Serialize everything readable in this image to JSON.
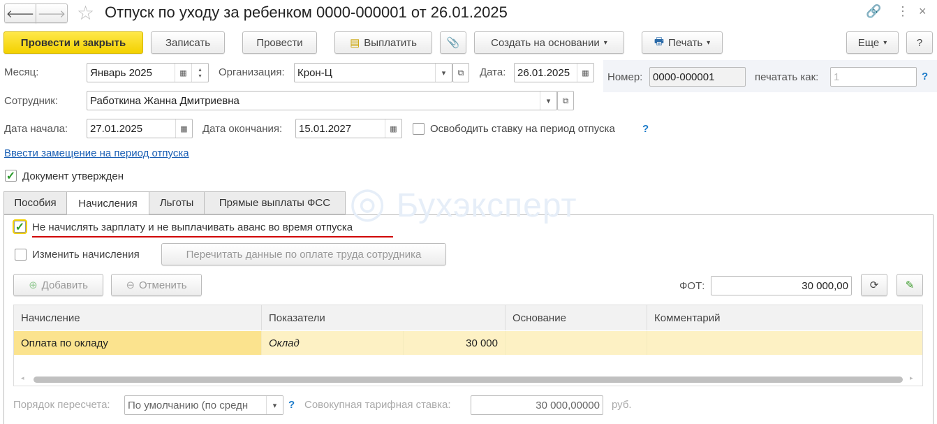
{
  "title": "Отпуск по уходу за ребенком 0000-000001 от 26.01.2025",
  "toolbar": {
    "post_close": "Провести и закрыть",
    "save": "Записать",
    "post": "Провести",
    "pay": "Выплатить",
    "create_based": "Создать на основании",
    "print": "Печать",
    "more": "Еще",
    "help": "?"
  },
  "form": {
    "month_label": "Месяц:",
    "month": "Январь 2025",
    "org_label": "Организация:",
    "org": "Крон-Ц",
    "date_label": "Дата:",
    "date": "26.01.2025",
    "number_label": "Номер:",
    "number": "0000-000001",
    "print_as_label": "печатать как:",
    "print_as": "1",
    "employee_label": "Сотрудник:",
    "employee": "Работкина Жанна Дмитриевна",
    "start_label": "Дата начала:",
    "start": "27.01.2025",
    "end_label": "Дата окончания:",
    "end": "15.01.2027",
    "free_rate_label": "Освободить ставку на период отпуска",
    "replacement_link": "Ввести замещение на период отпуска",
    "approved_label": "Документ утвержден",
    "help": "?"
  },
  "tabs": [
    {
      "label": "Пособия"
    },
    {
      "label": "Начисления"
    },
    {
      "label": "Льготы"
    },
    {
      "label": "Прямые выплаты ФСС"
    }
  ],
  "watermark": "Бухэксперт",
  "accruals": {
    "no_salary_label": "Не начислять зарплату и не выплачивать аванс во время отпуска",
    "change_label": "Изменить начисления",
    "reread_button": "Перечитать данные по оплате труда сотрудника",
    "add": "Добавить",
    "cancel": "Отменить",
    "fot_label": "ФОТ:",
    "fot": "30 000,00",
    "columns": [
      "Начисление",
      "Показатели",
      "Основание",
      "Комментарий"
    ],
    "rows": [
      {
        "accrual": "Оплата по окладу",
        "indicator": "Оклад",
        "value": "30 000",
        "basis": "",
        "comment": ""
      }
    ],
    "recalc_label": "Порядок пересчета:",
    "recalc": "По умолчанию (по средн",
    "rate_label": "Совокупная тарифная ставка:",
    "rate": "30 000,00000",
    "currency": "руб."
  },
  "colors": {
    "primary": "#f3d100",
    "accent": "#1a7ac9",
    "selected_row": "#fdf1c4",
    "underline": "#d00000"
  }
}
